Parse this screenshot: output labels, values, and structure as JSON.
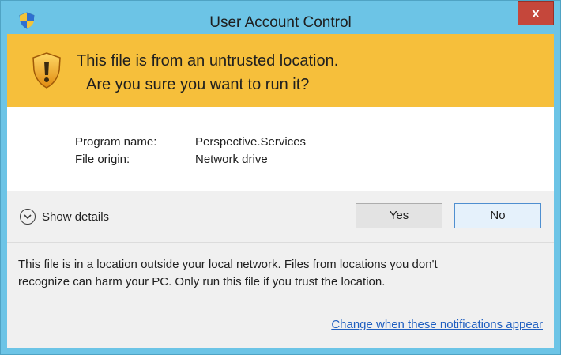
{
  "window": {
    "title": "User Account Control",
    "close_label": "x"
  },
  "banner": {
    "line1": "This file is from an untrusted location.",
    "line2": "Are you sure you want to run it?"
  },
  "details": {
    "program_name_label": "Program name:",
    "program_name_value": "Perspective.Services",
    "file_origin_label": "File origin:",
    "file_origin_value": "Network drive"
  },
  "actions": {
    "show_details_label": "Show details",
    "yes_label": "Yes",
    "no_label": "No"
  },
  "footer": {
    "message_line1": "This file is in a location outside your local network. Files from locations you don't",
    "message_line2": "recognize can harm your PC. Only run this file if you trust the location.",
    "link_label": "Change when these notifications appear"
  },
  "colors": {
    "titlebar": "#6cc4e6",
    "banner": "#f6bf3b",
    "close_button": "#c5473b",
    "link": "#1f5fc0"
  },
  "icons": {
    "title": "uac-shield-icon",
    "banner": "warning-shield-icon",
    "details": "chevron-down-circle-icon",
    "close": "close-icon"
  }
}
